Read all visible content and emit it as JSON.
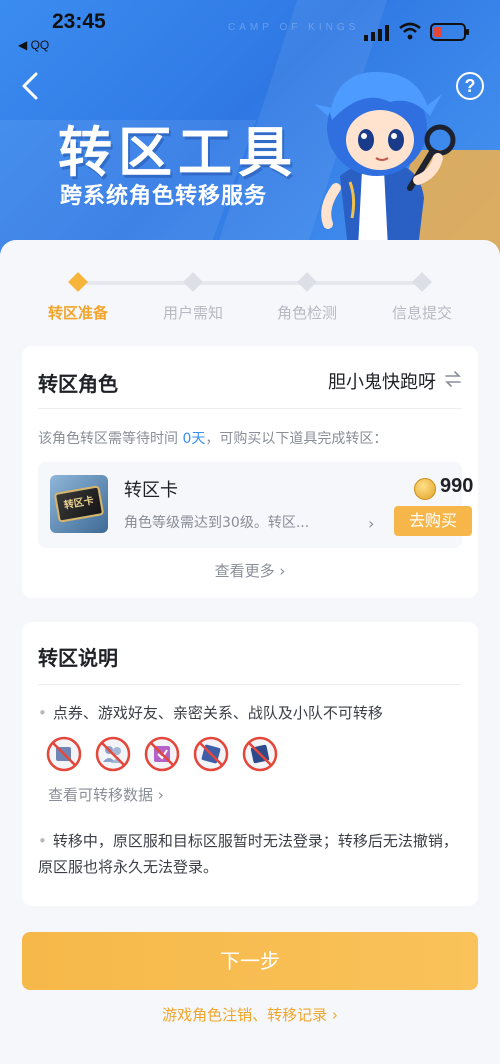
{
  "status_bar": {
    "time": "23:45",
    "back_app": "◀ QQ"
  },
  "hero": {
    "watermark": "CAMP OF KINGS",
    "title": "转区工具",
    "subtitle": "跨系统角色转移服务",
    "help_glyph": "?"
  },
  "steps": [
    {
      "label": "转区准备",
      "active": true
    },
    {
      "label": "用户需知",
      "active": false
    },
    {
      "label": "角色检测",
      "active": false
    },
    {
      "label": "信息提交",
      "active": false
    }
  ],
  "role_card": {
    "title": "转区角色",
    "role_name": "胆小鬼快跑呀",
    "wait_prefix": "该角色转区需等待时间",
    "wait_days": "0天",
    "wait_suffix": "，可购买以下道具完成转区：",
    "item": {
      "icon_text": "转区卡",
      "name": "转区卡",
      "desc": "角色等级需达到30级。转区...",
      "chevron": "›",
      "price": "990",
      "buy_label": "去购买"
    },
    "see_more": "查看更多 ›"
  },
  "notes_card": {
    "title": "转区说明",
    "note1": "点券、游戏好友、亲密关系、战队及小队不可转移",
    "forbidden_icons": [
      "ticket-icon",
      "friends-icon",
      "relationship-icon",
      "team-icon",
      "squad-icon"
    ],
    "view_data": "查看可转移数据 ›",
    "note2": "转移中，原区服和目标区服暂时无法登录；转移后无法撤销，原区服也将永久无法登录。",
    "bullet": "•"
  },
  "actions": {
    "next_label": "下一步",
    "bottom_link": "游戏角色注销、转移记录 ›"
  },
  "colors": {
    "accent": "#f6b43a",
    "primary_blue": "#3b8cf0",
    "link_blue": "#3a8ff0",
    "forbid_red": "#e5463a"
  }
}
